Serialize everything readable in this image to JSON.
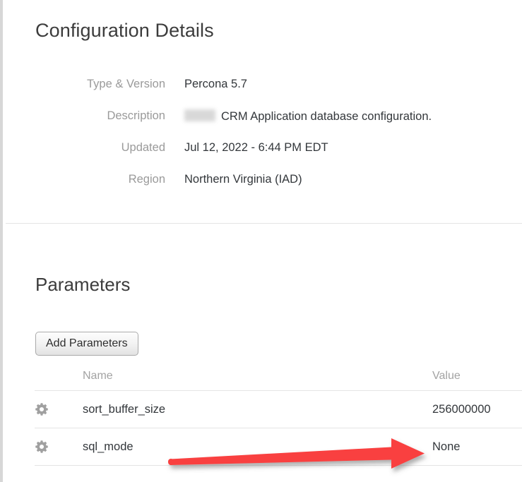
{
  "header": {
    "title": "Configuration Details"
  },
  "details": {
    "rows": [
      {
        "label": "Type & Version",
        "value": "Percona 5.7",
        "redacted": false
      },
      {
        "label": "Description",
        "value": "CRM Application database configuration.",
        "redacted": true
      },
      {
        "label": "Updated",
        "value": "Jul 12, 2022 - 6:44 PM EDT",
        "redacted": false
      },
      {
        "label": "Region",
        "value": "Northern Virginia (IAD)",
        "redacted": false
      }
    ]
  },
  "parameters": {
    "title": "Parameters",
    "add_button_label": "Add Parameters",
    "columns": {
      "name": "Name",
      "value": "Value"
    },
    "rows": [
      {
        "icon": "gear-icon",
        "name": "sort_buffer_size",
        "value": "256000000",
        "value_muted": false
      },
      {
        "icon": "gear-icon",
        "name": "sql_mode",
        "value": "None",
        "value_muted": true
      }
    ]
  },
  "annotation": {
    "type": "arrow",
    "direction": "right",
    "color": "#f9403f",
    "target": "sql_mode value cell"
  },
  "colors": {
    "page_background": "#ffffff",
    "heading_text": "#3c3c3c",
    "label_text": "#9a9a9a",
    "value_text": "#33373b",
    "muted_text": "#9a9a9a",
    "divider": "#e4e4e4",
    "gear_icon": "#a0a0a0",
    "annotation_red": "#f9403f"
  }
}
